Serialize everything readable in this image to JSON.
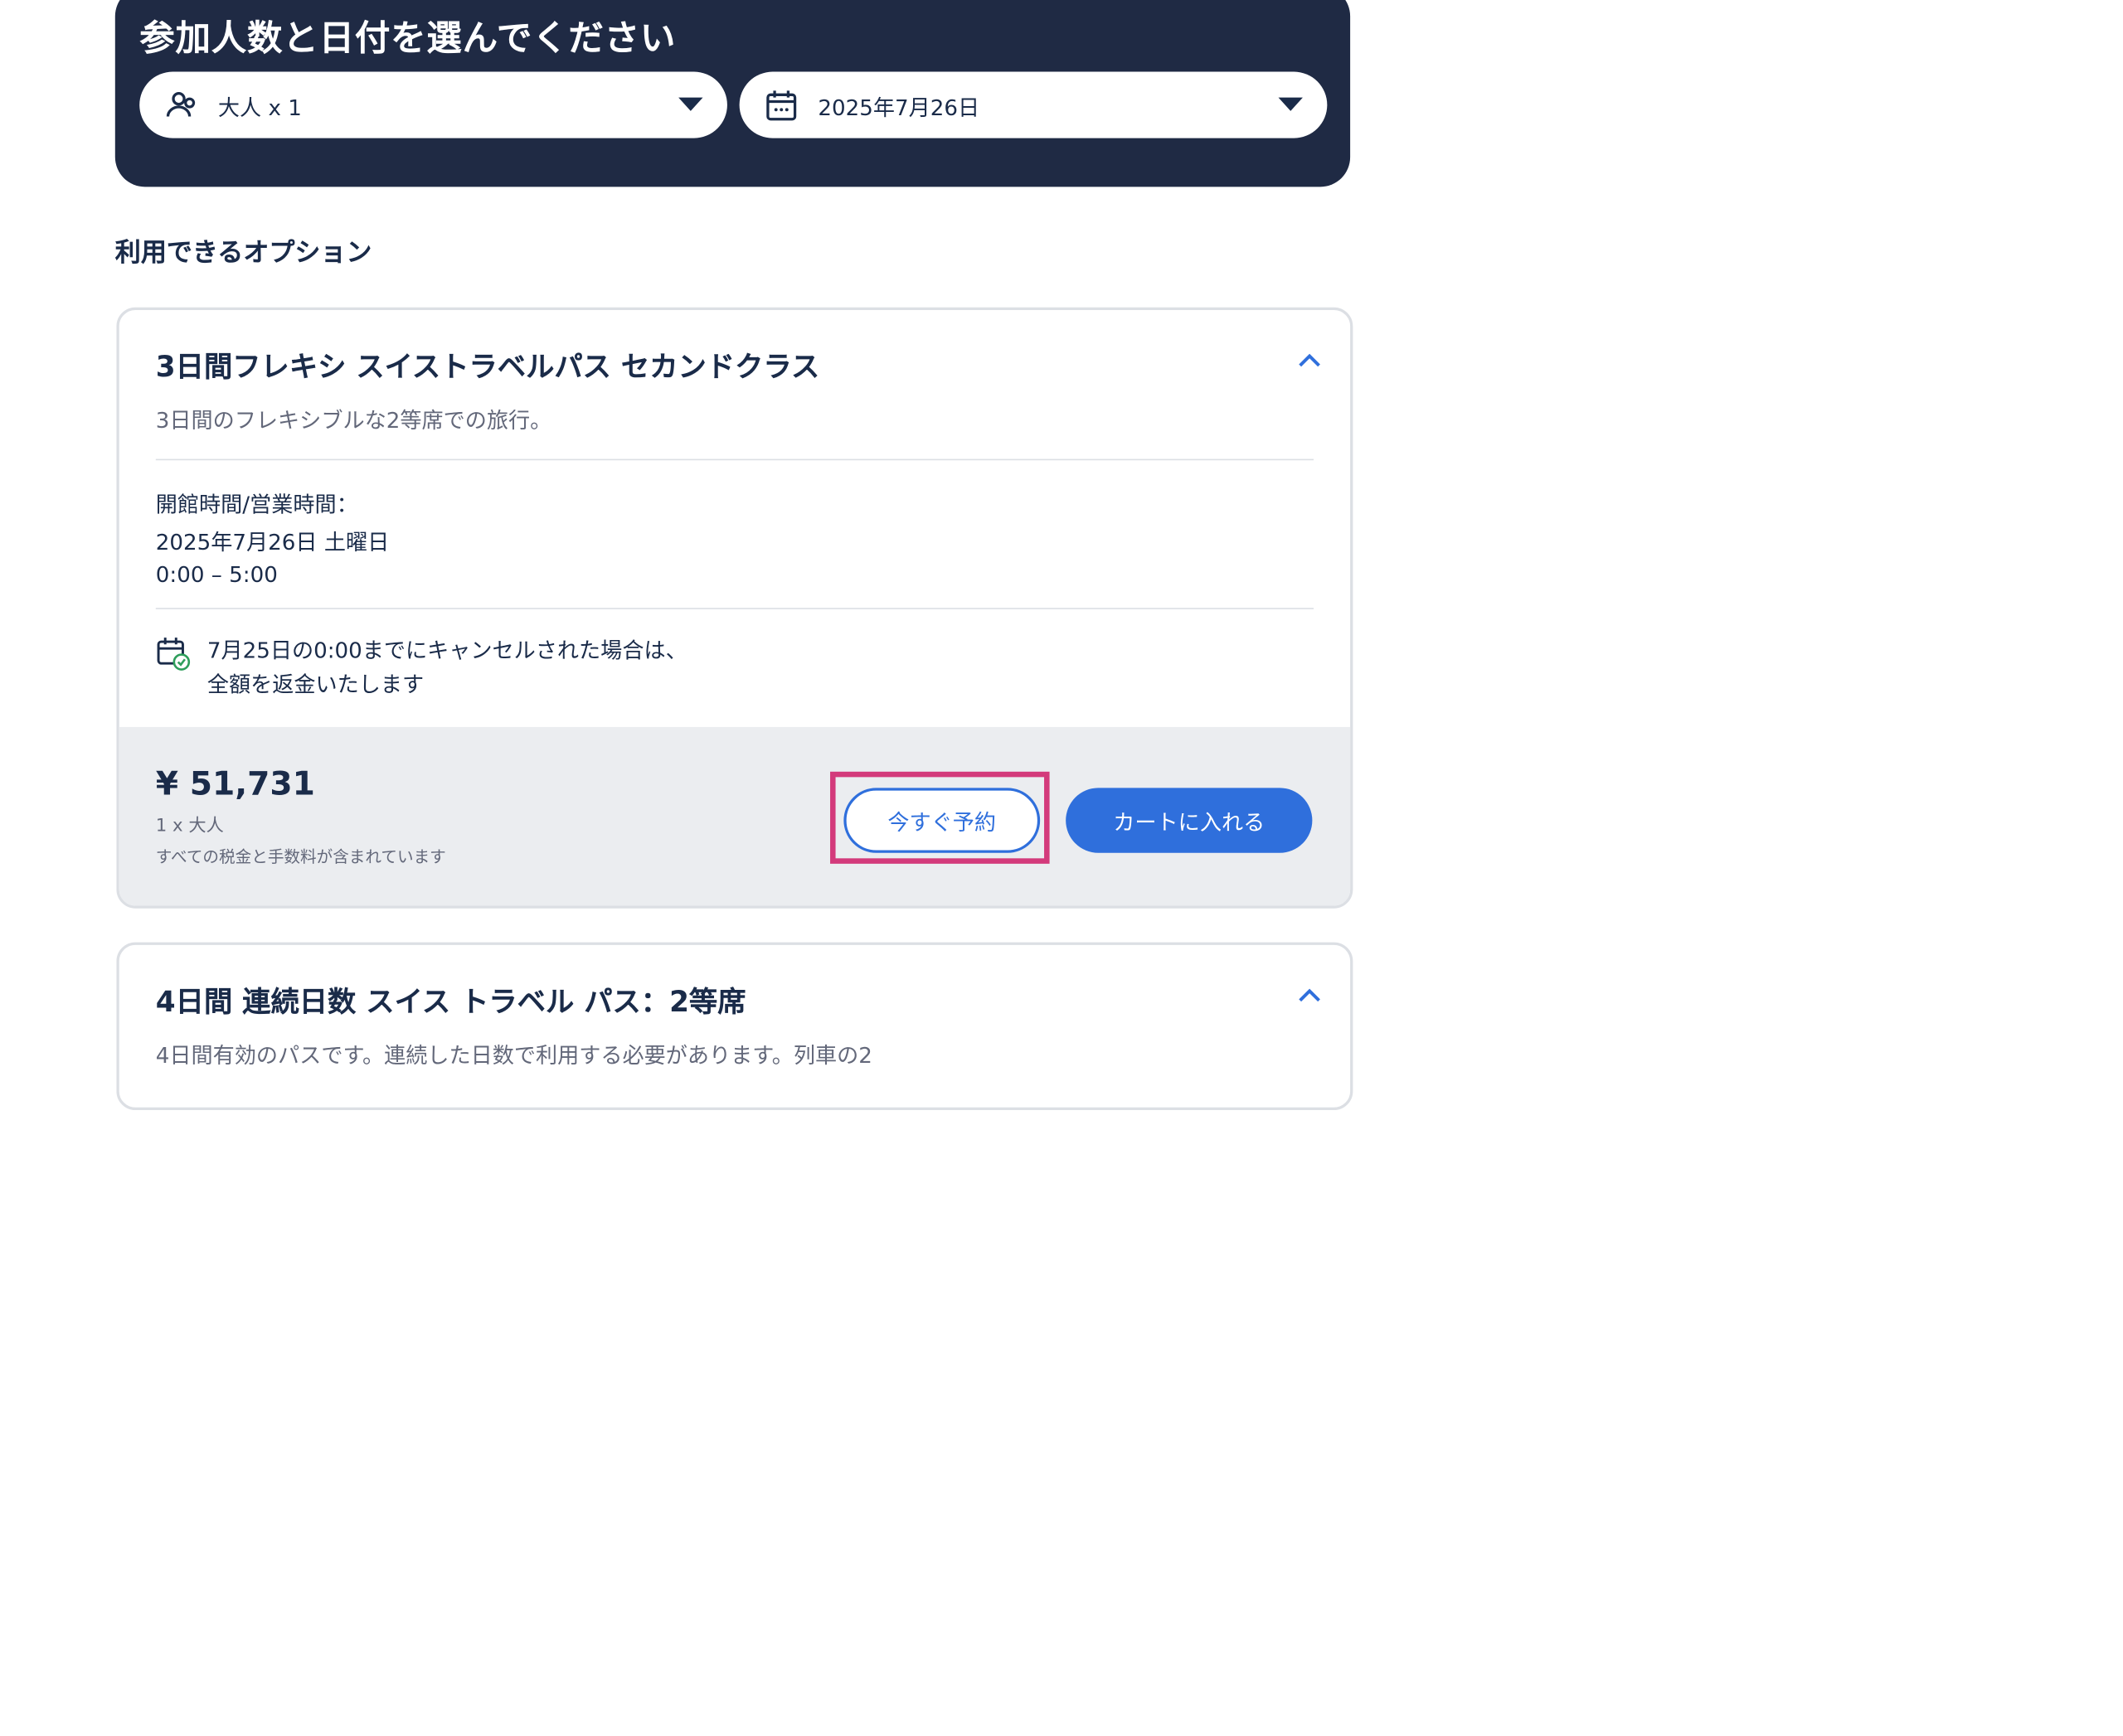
{
  "selector": {
    "title": "参加人数と日付を選んでください",
    "participants_value": "大人 x 1",
    "date_value": "2025年7月26日"
  },
  "options_heading": "利用できるオプション",
  "options": [
    {
      "title": "3日間フレキシ スイストラベルパス セカンドクラス",
      "subtitle": "3日間のフレキシブルな2等席での旅行。",
      "hours_label": "開館時間/営業時間：",
      "hours_date": "2025年7月26日 土曜日",
      "hours_range": "0:00 – 5:00",
      "cancellation": "7月25日の0:00までにキャンセルされた場合は、全額を返金いたします",
      "price": "¥ 51,731",
      "quantity": "1 x 大人",
      "tax_note": "すべての税金と手数料が含まれています",
      "book_now_label": "今すぐ予約",
      "add_to_cart_label": "カートに入れる"
    },
    {
      "title": "4日間 連続日数 スイス トラベル パス：2等席",
      "subtitle": "4日間有効のパスです。連続した日数で利用する必要があります。列車の2"
    }
  ],
  "icons": {
    "participants": "people-icon",
    "date": "calendar-icon",
    "cancellation": "calendar-check-icon",
    "collapse": "chevron-up-icon",
    "dropdown": "caret-down-icon"
  },
  "colors": {
    "panel_bg": "#1f2a44",
    "primary": "#2f6fdc",
    "highlight": "#d33a7b",
    "text": "#1a2b49",
    "muted": "#63687a",
    "price_bar_bg": "#ebedf0"
  }
}
